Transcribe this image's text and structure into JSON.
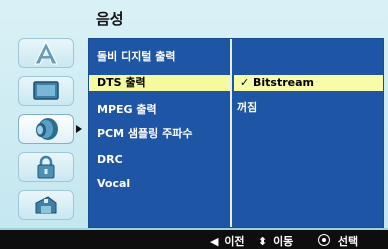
{
  "header": {
    "title": "음성"
  },
  "categories": [
    {
      "icon": "letter-a-icon"
    },
    {
      "icon": "tv-screen-icon"
    },
    {
      "icon": "speaker-icon",
      "active": true
    },
    {
      "icon": "lock-icon"
    },
    {
      "icon": "other-settings-icon"
    }
  ],
  "menu": {
    "items": [
      {
        "label": "돌비 디지털 출력"
      },
      {
        "label": "DTS 출력",
        "selected": true
      },
      {
        "label": "MPEG 출력"
      },
      {
        "label": "PCM 샘플링 주파수"
      },
      {
        "label": "DRC"
      },
      {
        "label": "Vocal"
      }
    ]
  },
  "options": {
    "items": [
      {
        "label": "Bitstream",
        "checked": true
      },
      {
        "label": "꺼짐"
      }
    ]
  },
  "footer": {
    "prev_symbol": "◀",
    "prev_label": "이전",
    "move_symbol": "⬍",
    "move_label": "이동",
    "select_label": "선택"
  },
  "colors": {
    "panel_bg": "#1f55a5",
    "highlight": "#f5fa9f",
    "background": "#cfeef5",
    "footer_bg": "#0e0e0e"
  }
}
